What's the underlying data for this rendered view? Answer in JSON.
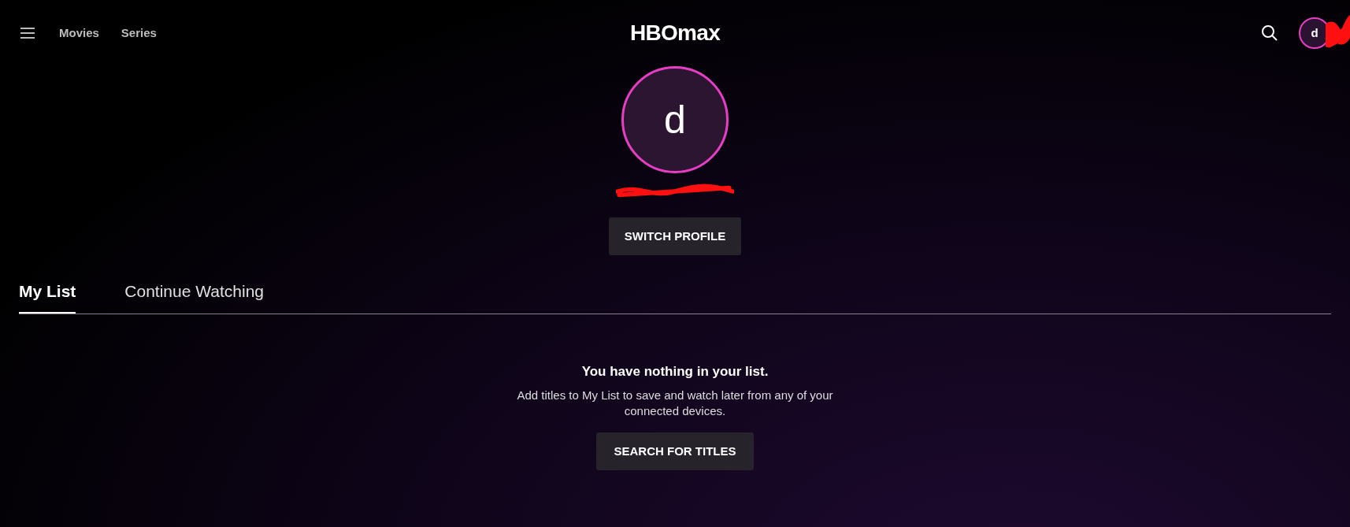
{
  "nav": {
    "links": [
      "Movies",
      "Series"
    ],
    "logo": "HBOmax",
    "avatar_initial": "d"
  },
  "profile": {
    "initial": "d",
    "button": "SWITCH PROFILE"
  },
  "tabs": [
    {
      "label": "My List",
      "selected": true
    },
    {
      "label": "Continue Watching",
      "selected": false
    }
  ],
  "empty_state": {
    "title": "You have nothing in your list.",
    "message": "Add titles to My List to save and watch later from any of your connected devices.",
    "button": "SEARCH FOR TITLES"
  }
}
